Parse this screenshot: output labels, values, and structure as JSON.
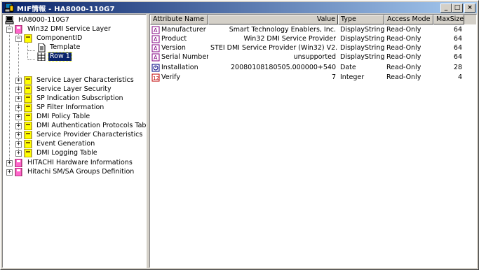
{
  "window": {
    "title": "MIF情報 - HA8000-110G7",
    "minimize_label": "_",
    "maximize_label": "□",
    "close_label": "×"
  },
  "tree": {
    "root": "HA8000-110G7",
    "items": [
      {
        "label": "Win32 DMI Service Layer",
        "expander": "−"
      },
      {
        "label": "ComponentID",
        "expander": "−"
      },
      {
        "label": "Template"
      },
      {
        "label": "Row 1"
      },
      {
        "label": "Service Layer Characteristics",
        "expander": "+"
      },
      {
        "label": "Service Layer Security",
        "expander": "+"
      },
      {
        "label": "SP Indication Subscription",
        "expander": "+"
      },
      {
        "label": "SP Filter Information",
        "expander": "+"
      },
      {
        "label": "DMI Policy Table",
        "expander": "+"
      },
      {
        "label": "DMI Authentication Protocols Table",
        "expander": "+"
      },
      {
        "label": "Service Provider Characteristics",
        "expander": "+"
      },
      {
        "label": "Event Generation",
        "expander": "+"
      },
      {
        "label": "DMI Logging Table",
        "expander": "+"
      },
      {
        "label": "HITACHI Hardware Informations",
        "expander": "+"
      },
      {
        "label": "Hitachi SM/SA Groups Definition",
        "expander": "+"
      }
    ],
    "selected": "Row 1"
  },
  "list": {
    "columns": [
      "Attribute Name",
      "Value",
      "Type",
      "Access Mode",
      "MaxSize"
    ],
    "rows": [
      {
        "name": "Manufacturer",
        "value": "Smart Technology Enablers, Inc.",
        "type": "DisplayString",
        "access": "Read-Only",
        "maxsize": "64",
        "icon": "string-attribute-icon"
      },
      {
        "name": "Product",
        "value": "Win32 DMI Service Provider",
        "type": "DisplayString",
        "access": "Read-Only",
        "maxsize": "64",
        "icon": "string-attribute-icon"
      },
      {
        "name": "Version",
        "value": "STEI  DMI Service Provider (Win32) V2.71",
        "type": "DisplayString",
        "access": "Read-Only",
        "maxsize": "64",
        "icon": "string-attribute-icon"
      },
      {
        "name": "Serial Number",
        "value": "unsupported",
        "type": "DisplayString",
        "access": "Read-Only",
        "maxsize": "64",
        "icon": "string-attribute-icon"
      },
      {
        "name": "Installation",
        "value": "20080108180505.000000+540",
        "type": "Date",
        "access": "Read-Only",
        "maxsize": "28",
        "icon": "date-attribute-icon"
      },
      {
        "name": "Verify",
        "value": "7",
        "type": "Integer",
        "access": "Read-Only",
        "maxsize": "4",
        "icon": "integer-attribute-icon"
      }
    ]
  }
}
